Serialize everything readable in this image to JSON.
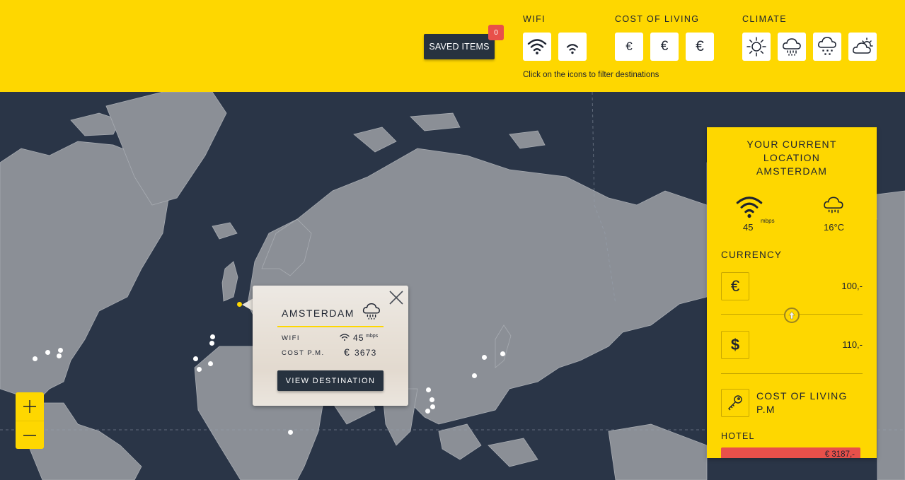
{
  "header": {
    "saved_label": "SAVED ITEMS",
    "saved_count": "0",
    "wifi_title": "WIFI",
    "cost_title": "COST OF LIVING",
    "climate_title": "CLIMATE",
    "hint": "Click on the icons to filter destinations",
    "cost_icons": [
      "€",
      "€",
      "€"
    ]
  },
  "popup": {
    "city": "AMSTERDAM",
    "wifi_label": "WIFI",
    "wifi_value": "45",
    "wifi_unit": "mbps",
    "cost_label": "COST P.M.",
    "cost_currency": "€",
    "cost_value": "3673",
    "button": "VIEW DESTINATION"
  },
  "panel": {
    "title_line1": "YOUR CURRENT",
    "title_line2": "LOCATION",
    "title_line3": "AMSTERDAM",
    "wifi_value": "45",
    "wifi_unit": "mbps",
    "temperature": "16°C",
    "currency_label": "CURRENCY",
    "currency_from_symbol": "€",
    "currency_from_value": "100,-",
    "currency_to_symbol": "$",
    "currency_to_value": "110,-",
    "cost_title_line1": "COST OF LIVING",
    "cost_title_line2": "P.M",
    "hotel_label": "HOTEL",
    "hotel_value": "€ 3187,-"
  },
  "colors": {
    "accent": "#fed700",
    "map_water": "#2a3547",
    "map_land": "#8b8f96",
    "dark": "#27323f",
    "badge": "#e8504a"
  }
}
